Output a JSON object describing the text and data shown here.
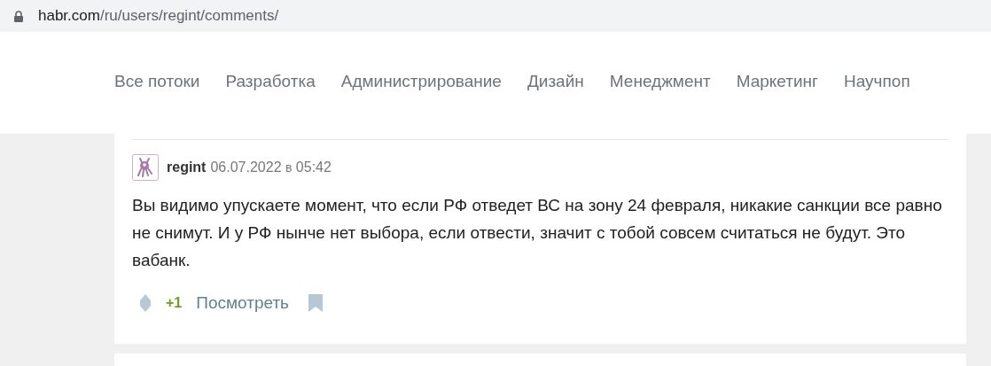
{
  "address_bar": {
    "url_host": "habr.com",
    "url_path": "/ru/users/regint/comments/"
  },
  "nav": {
    "items": [
      {
        "label": "Все потоки"
      },
      {
        "label": "Разработка"
      },
      {
        "label": "Администрирование"
      },
      {
        "label": "Дизайн"
      },
      {
        "label": "Менеджмент"
      },
      {
        "label": "Маркетинг"
      },
      {
        "label": "Научпоп"
      }
    ]
  },
  "comment": {
    "author": "regint",
    "date": "06.07.2022",
    "at": "в",
    "time": "05:42",
    "text": "Вы видимо упускаете момент, что если РФ отведет ВС на зону 24 февраля, никакие санкции все равно не снимут. И у РФ нынче нет выбора, если отвести, значит с тобой совсем считаться не будут. Это вабанк.",
    "score": "+1",
    "view_link": "Посмотреть"
  }
}
